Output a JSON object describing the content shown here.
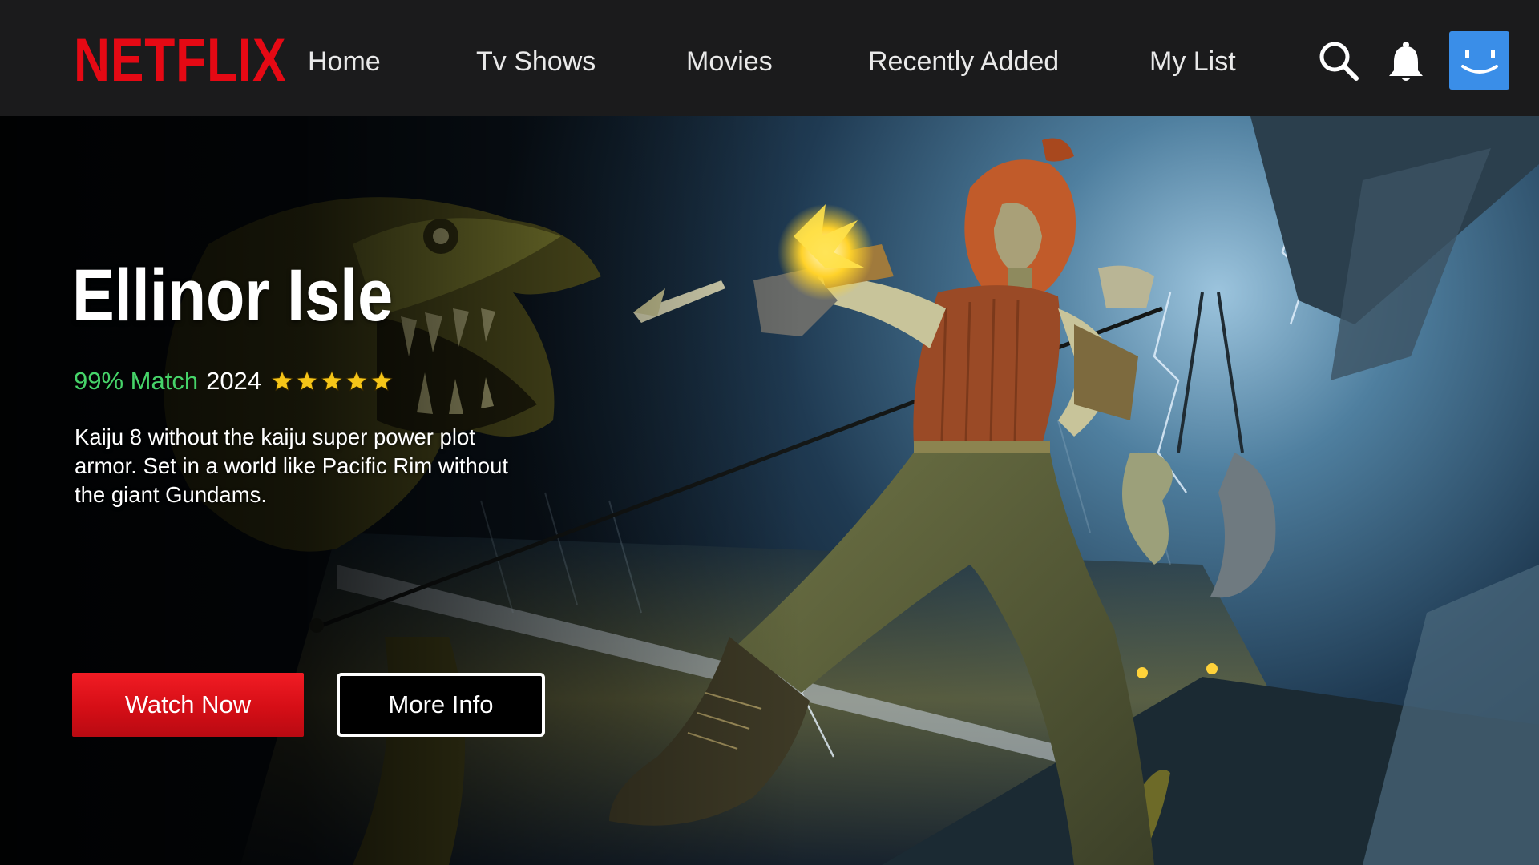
{
  "nav": {
    "logo": "NETFLIX",
    "links": [
      "Home",
      "Tv Shows",
      "Movies",
      "Recently Added",
      "My List"
    ],
    "icons": [
      "search-icon",
      "bell-icon",
      "profile-avatar"
    ]
  },
  "hero": {
    "title": "Ellinor Isle",
    "match": "99% Match",
    "year": "2024",
    "rating_stars": 5,
    "description": "Kaiju 8 without the kaiju super power plot armor. Set in a world like Pacific Rim without the giant Gundams.",
    "buttons": {
      "primary": "Watch Now",
      "secondary": "More Info"
    }
  },
  "colors": {
    "brand_red": "#e50914",
    "match_green": "#46d369",
    "star_gold": "#f5c518",
    "avatar_blue": "#3a8ee8",
    "navbar_bg": "#1b1b1c"
  }
}
